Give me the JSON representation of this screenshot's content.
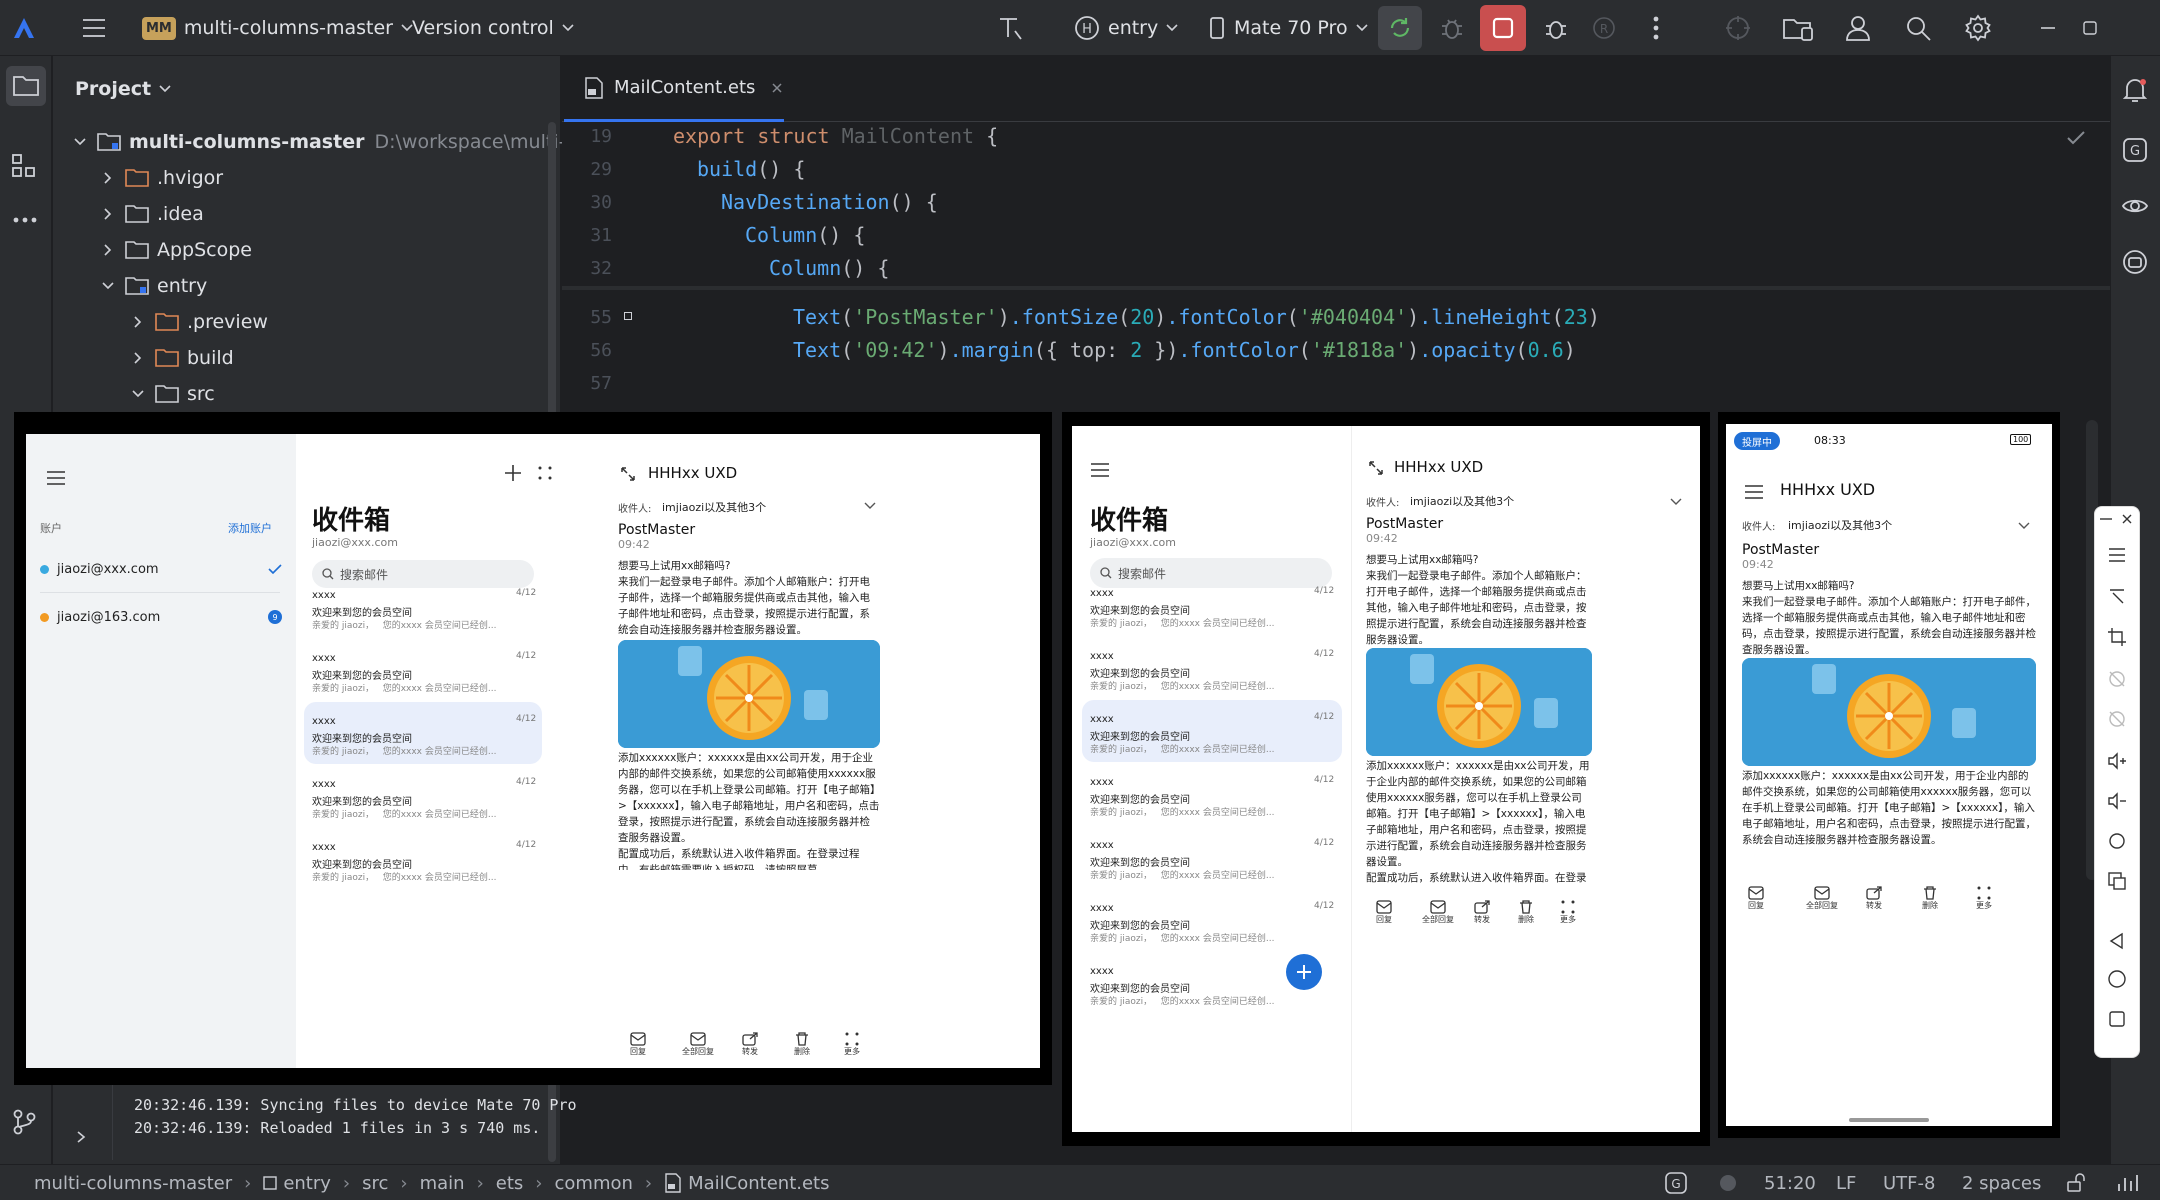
{
  "topbar": {
    "project_badge": "MM",
    "project_name": "multi-columns-master",
    "vcs_label": "Version control",
    "run_config": "entry",
    "device": "Mate 70 Pro"
  },
  "project_panel": {
    "title": "Project",
    "root_name": "multi-columns-master",
    "root_path": "D:\\workspace\\multi-colu",
    "items": [
      {
        "label": ".hvigor"
      },
      {
        "label": ".idea"
      },
      {
        "label": "AppScope"
      },
      {
        "label": "entry"
      },
      {
        "label": ".preview"
      },
      {
        "label": "build"
      },
      {
        "label": "src"
      }
    ]
  },
  "editor": {
    "tab_name": "MailContent.ets",
    "line_numbers": [
      "19",
      "29",
      "30",
      "31",
      "32",
      "55",
      "56",
      "57"
    ],
    "lines": [
      {
        "a": "export struct ",
        "b": "MailContent",
        "c": " {"
      },
      {
        "a": "build",
        "b": "() {"
      },
      {
        "a": "NavDestination",
        "b": "() {"
      },
      {
        "a": "Column",
        "b": "() {"
      },
      {
        "a": "Column",
        "b": "() {"
      }
    ],
    "line55": {
      "f1": "Text",
      "s1": "'PostMaster'",
      "f2": ".fontSize",
      "n1": "20",
      "f3": ".fontColor",
      "s2": "'#040404'",
      "f4": ".lineHeight",
      "n2": "23"
    },
    "line56": {
      "f1": "Text",
      "s1": "'09:42'",
      "f2": ".margin",
      "p": "top",
      "n1": "2",
      "f3": ".fontColor",
      "s2": "'#1818a'",
      "f4": ".opacity",
      "n2": "0.6"
    }
  },
  "log": [
    "20:32:46.139: Syncing files to device Mate 70 Pro",
    "20:32:46.139: Reloaded 1 files in 3 s 740 ms."
  ],
  "statusbar": {
    "crumbs": [
      "multi-columns-master",
      "entry",
      "src",
      "main",
      "ets",
      "common",
      "MailContent.ets"
    ],
    "position": "51:20",
    "line_sep": "LF",
    "encoding": "UTF-8",
    "indent": "2 spaces"
  },
  "mail": {
    "account_label": "账户",
    "add_account": "添加账户",
    "accounts": [
      "jiaozi@xxx.com",
      "jiaozi@163.com"
    ],
    "unread_badge": "9",
    "inbox_title": "收件箱",
    "inbox_email": "jiaozi@xxx.com",
    "search_placeholder": "搜索邮件",
    "item_sender": "xxxx",
    "item_date": "4/12",
    "item_subject": "欢迎来到您的会员空间",
    "item_preview_a": "亲爱的 jiaozi，",
    "item_preview_b": "您的xxxx 会员空间已经创...",
    "detail_sender": "HHHxx UXD",
    "recipients_label": "收件人:",
    "recipients": "imjiaozi以及其他3个",
    "from_name": "PostMaster",
    "time": "09:42",
    "body_1": "想要马上试用xx邮箱吗?",
    "body_2": "来我们一起登录电子邮件。添加个人邮箱账户：打开电子邮件，选择一个邮箱服务提供商或点击其他，输入电子邮件地址和密码，点击登录，按照提示进行配置，系统会自动连接服务器并检查服务器设置。",
    "body_3": "添加xxxxxx账户：xxxxxx是由xx公司开发，用于企业内部的邮件交换系统，如果您的公司邮箱使用xxxxxx服务器，您可以在手机上登录公司邮箱。打开【电子邮箱】>【xxxxxx】，输入电子邮箱地址，用户名和密码，点击登录，按照提示进行配置，系统会自动连接服务器并检查服务器设置。",
    "body_4": "配置成功后，系统默认进入收件箱界面。在登录过程中，有些邮箱需要收入授权码，请按照屏幕",
    "actions": [
      "回复",
      "全部回复",
      "转发",
      "删除",
      "更多"
    ],
    "phone_status": "投屏中",
    "phone_time": "08:33",
    "phone_battery": "100"
  }
}
